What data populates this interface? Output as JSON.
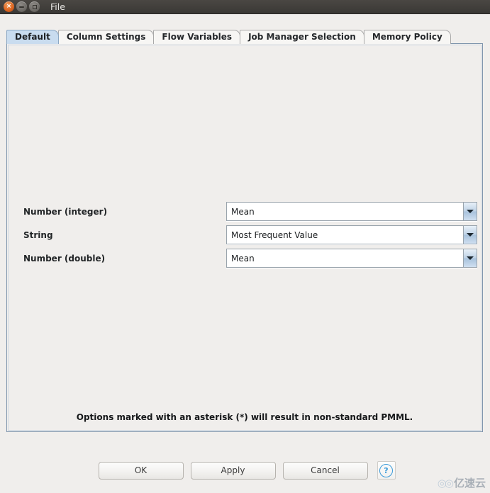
{
  "window": {
    "title": "File",
    "controls": [
      {
        "name": "close",
        "glyph": "×"
      },
      {
        "name": "minimize",
        "glyph": ""
      },
      {
        "name": "maximize",
        "glyph": ""
      }
    ]
  },
  "tabs": [
    {
      "label": "Default",
      "selected": true
    },
    {
      "label": "Column Settings",
      "selected": false
    },
    {
      "label": "Flow Variables",
      "selected": false
    },
    {
      "label": "Job Manager Selection",
      "selected": false
    },
    {
      "label": "Memory Policy",
      "selected": false
    }
  ],
  "form": {
    "rows": [
      {
        "label": "Number (integer)",
        "value": "Mean"
      },
      {
        "label": "String",
        "value": "Most Frequent Value"
      },
      {
        "label": "Number (double)",
        "value": "Mean"
      }
    ]
  },
  "footnote": "Options marked with an asterisk (*) will result in non-standard PMML.",
  "buttons": {
    "ok": "OK",
    "apply": "Apply",
    "cancel": "Cancel",
    "help": "?"
  },
  "watermark": {
    "glyph": "◎◎",
    "text": "亿速云"
  },
  "colors": {
    "titlebar": "#3a3835",
    "panel_border": "#7f95ad",
    "tab_selected": "#c9dcef",
    "accent_help": "#3a9ad9",
    "background": "#f0eeec"
  }
}
